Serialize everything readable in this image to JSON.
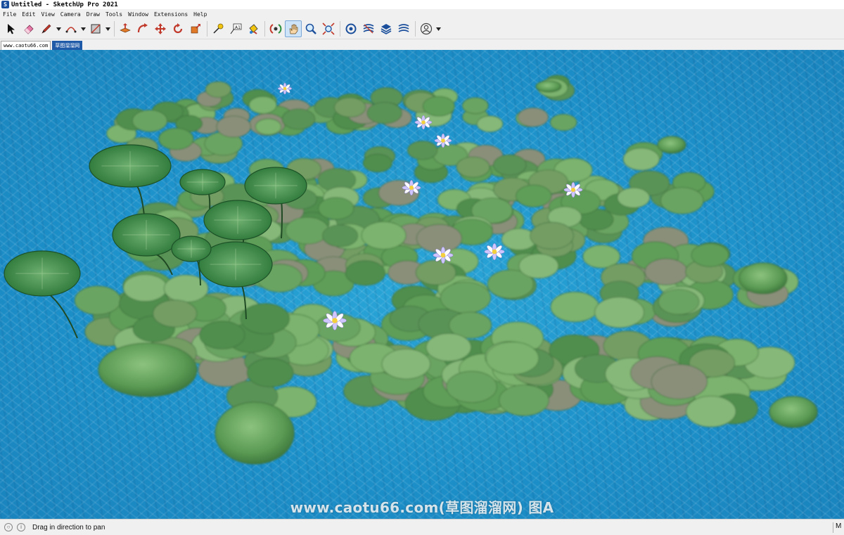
{
  "window": {
    "title": "Untitled - SketchUp Pro 2021"
  },
  "menu": [
    "File",
    "Edit",
    "View",
    "Camera",
    "Draw",
    "Tools",
    "Window",
    "Extensions",
    "Help"
  ],
  "toolbar": {
    "tools": [
      {
        "name": "select-tool",
        "icon": "arrow-cursor-icon"
      },
      {
        "name": "eraser-tool",
        "icon": "eraser-icon"
      },
      {
        "name": "line-tool",
        "icon": "pencil-icon",
        "dropdown": true
      },
      {
        "name": "arc-tool",
        "icon": "arc-icon",
        "dropdown": true
      },
      {
        "name": "rectangle-tool",
        "icon": "rectangle-icon",
        "dropdown": true
      },
      {
        "name": "push-pull-tool",
        "icon": "push-pull-icon"
      },
      {
        "name": "follow-me-tool",
        "icon": "follow-me-icon"
      },
      {
        "name": "move-tool",
        "icon": "move-arrows-icon"
      },
      {
        "name": "rotate-tool",
        "icon": "rotate-icon"
      },
      {
        "name": "scale-tool",
        "icon": "scale-icon"
      },
      {
        "name": "tape-measure-tool",
        "icon": "tape-measure-icon"
      },
      {
        "name": "text-tool",
        "icon": "text-icon"
      },
      {
        "name": "paint-bucket-tool",
        "icon": "paint-bucket-icon"
      },
      {
        "name": "orbit-tool",
        "icon": "orbit-icon"
      },
      {
        "name": "pan-tool",
        "icon": "hand-icon",
        "active": true
      },
      {
        "name": "zoom-tool",
        "icon": "magnifier-icon"
      },
      {
        "name": "zoom-extents-tool",
        "icon": "zoom-extents-icon"
      },
      {
        "name": "3d-warehouse-button",
        "icon": "warehouse-icon"
      },
      {
        "name": "extension-warehouse-button",
        "icon": "extension-warehouse-icon"
      },
      {
        "name": "layout-button",
        "icon": "layers-icon"
      },
      {
        "name": "extension-manager-button",
        "icon": "extension-manager-icon"
      },
      {
        "name": "account-button",
        "icon": "user-circle-icon",
        "dropdown": true
      }
    ]
  },
  "scene_tabs": [
    {
      "label": "www.caotu66.com",
      "selected": false
    },
    {
      "label": "草图溜溜网",
      "selected": true
    }
  ],
  "viewport": {
    "watermark": "www.caotu66.com(草图溜溜网) 图A",
    "colors": {
      "water": "#1c8fc8",
      "lily_pad": "#5e9e58",
      "lotus_leaf": "#3f8f4a",
      "flower": "#dcd6ff"
    }
  },
  "status": {
    "message": "Drag in direction to pan",
    "measurements_label": "M"
  }
}
